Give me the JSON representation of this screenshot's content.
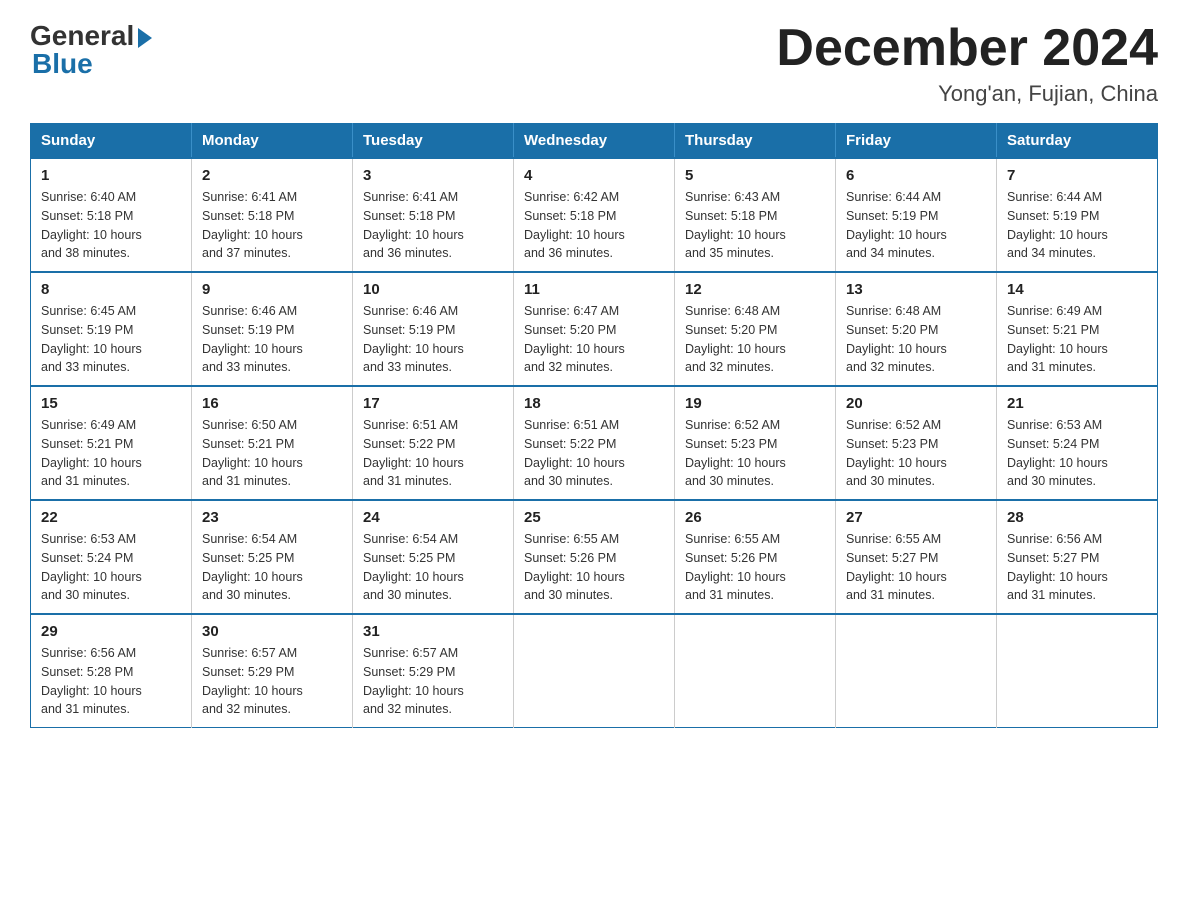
{
  "logo": {
    "general": "General",
    "blue": "Blue"
  },
  "title": "December 2024",
  "location": "Yong'an, Fujian, China",
  "days_of_week": [
    "Sunday",
    "Monday",
    "Tuesday",
    "Wednesday",
    "Thursday",
    "Friday",
    "Saturday"
  ],
  "weeks": [
    [
      {
        "day": "1",
        "sunrise": "6:40 AM",
        "sunset": "5:18 PM",
        "daylight": "10 hours and 38 minutes."
      },
      {
        "day": "2",
        "sunrise": "6:41 AM",
        "sunset": "5:18 PM",
        "daylight": "10 hours and 37 minutes."
      },
      {
        "day": "3",
        "sunrise": "6:41 AM",
        "sunset": "5:18 PM",
        "daylight": "10 hours and 36 minutes."
      },
      {
        "day": "4",
        "sunrise": "6:42 AM",
        "sunset": "5:18 PM",
        "daylight": "10 hours and 36 minutes."
      },
      {
        "day": "5",
        "sunrise": "6:43 AM",
        "sunset": "5:18 PM",
        "daylight": "10 hours and 35 minutes."
      },
      {
        "day": "6",
        "sunrise": "6:44 AM",
        "sunset": "5:19 PM",
        "daylight": "10 hours and 34 minutes."
      },
      {
        "day": "7",
        "sunrise": "6:44 AM",
        "sunset": "5:19 PM",
        "daylight": "10 hours and 34 minutes."
      }
    ],
    [
      {
        "day": "8",
        "sunrise": "6:45 AM",
        "sunset": "5:19 PM",
        "daylight": "10 hours and 33 minutes."
      },
      {
        "day": "9",
        "sunrise": "6:46 AM",
        "sunset": "5:19 PM",
        "daylight": "10 hours and 33 minutes."
      },
      {
        "day": "10",
        "sunrise": "6:46 AM",
        "sunset": "5:19 PM",
        "daylight": "10 hours and 33 minutes."
      },
      {
        "day": "11",
        "sunrise": "6:47 AM",
        "sunset": "5:20 PM",
        "daylight": "10 hours and 32 minutes."
      },
      {
        "day": "12",
        "sunrise": "6:48 AM",
        "sunset": "5:20 PM",
        "daylight": "10 hours and 32 minutes."
      },
      {
        "day": "13",
        "sunrise": "6:48 AM",
        "sunset": "5:20 PM",
        "daylight": "10 hours and 32 minutes."
      },
      {
        "day": "14",
        "sunrise": "6:49 AM",
        "sunset": "5:21 PM",
        "daylight": "10 hours and 31 minutes."
      }
    ],
    [
      {
        "day": "15",
        "sunrise": "6:49 AM",
        "sunset": "5:21 PM",
        "daylight": "10 hours and 31 minutes."
      },
      {
        "day": "16",
        "sunrise": "6:50 AM",
        "sunset": "5:21 PM",
        "daylight": "10 hours and 31 minutes."
      },
      {
        "day": "17",
        "sunrise": "6:51 AM",
        "sunset": "5:22 PM",
        "daylight": "10 hours and 31 minutes."
      },
      {
        "day": "18",
        "sunrise": "6:51 AM",
        "sunset": "5:22 PM",
        "daylight": "10 hours and 30 minutes."
      },
      {
        "day": "19",
        "sunrise": "6:52 AM",
        "sunset": "5:23 PM",
        "daylight": "10 hours and 30 minutes."
      },
      {
        "day": "20",
        "sunrise": "6:52 AM",
        "sunset": "5:23 PM",
        "daylight": "10 hours and 30 minutes."
      },
      {
        "day": "21",
        "sunrise": "6:53 AM",
        "sunset": "5:24 PM",
        "daylight": "10 hours and 30 minutes."
      }
    ],
    [
      {
        "day": "22",
        "sunrise": "6:53 AM",
        "sunset": "5:24 PM",
        "daylight": "10 hours and 30 minutes."
      },
      {
        "day": "23",
        "sunrise": "6:54 AM",
        "sunset": "5:25 PM",
        "daylight": "10 hours and 30 minutes."
      },
      {
        "day": "24",
        "sunrise": "6:54 AM",
        "sunset": "5:25 PM",
        "daylight": "10 hours and 30 minutes."
      },
      {
        "day": "25",
        "sunrise": "6:55 AM",
        "sunset": "5:26 PM",
        "daylight": "10 hours and 30 minutes."
      },
      {
        "day": "26",
        "sunrise": "6:55 AM",
        "sunset": "5:26 PM",
        "daylight": "10 hours and 31 minutes."
      },
      {
        "day": "27",
        "sunrise": "6:55 AM",
        "sunset": "5:27 PM",
        "daylight": "10 hours and 31 minutes."
      },
      {
        "day": "28",
        "sunrise": "6:56 AM",
        "sunset": "5:27 PM",
        "daylight": "10 hours and 31 minutes."
      }
    ],
    [
      {
        "day": "29",
        "sunrise": "6:56 AM",
        "sunset": "5:28 PM",
        "daylight": "10 hours and 31 minutes."
      },
      {
        "day": "30",
        "sunrise": "6:57 AM",
        "sunset": "5:29 PM",
        "daylight": "10 hours and 32 minutes."
      },
      {
        "day": "31",
        "sunrise": "6:57 AM",
        "sunset": "5:29 PM",
        "daylight": "10 hours and 32 minutes."
      },
      null,
      null,
      null,
      null
    ]
  ],
  "labels": {
    "sunrise": "Sunrise:",
    "sunset": "Sunset:",
    "daylight": "Daylight:"
  }
}
